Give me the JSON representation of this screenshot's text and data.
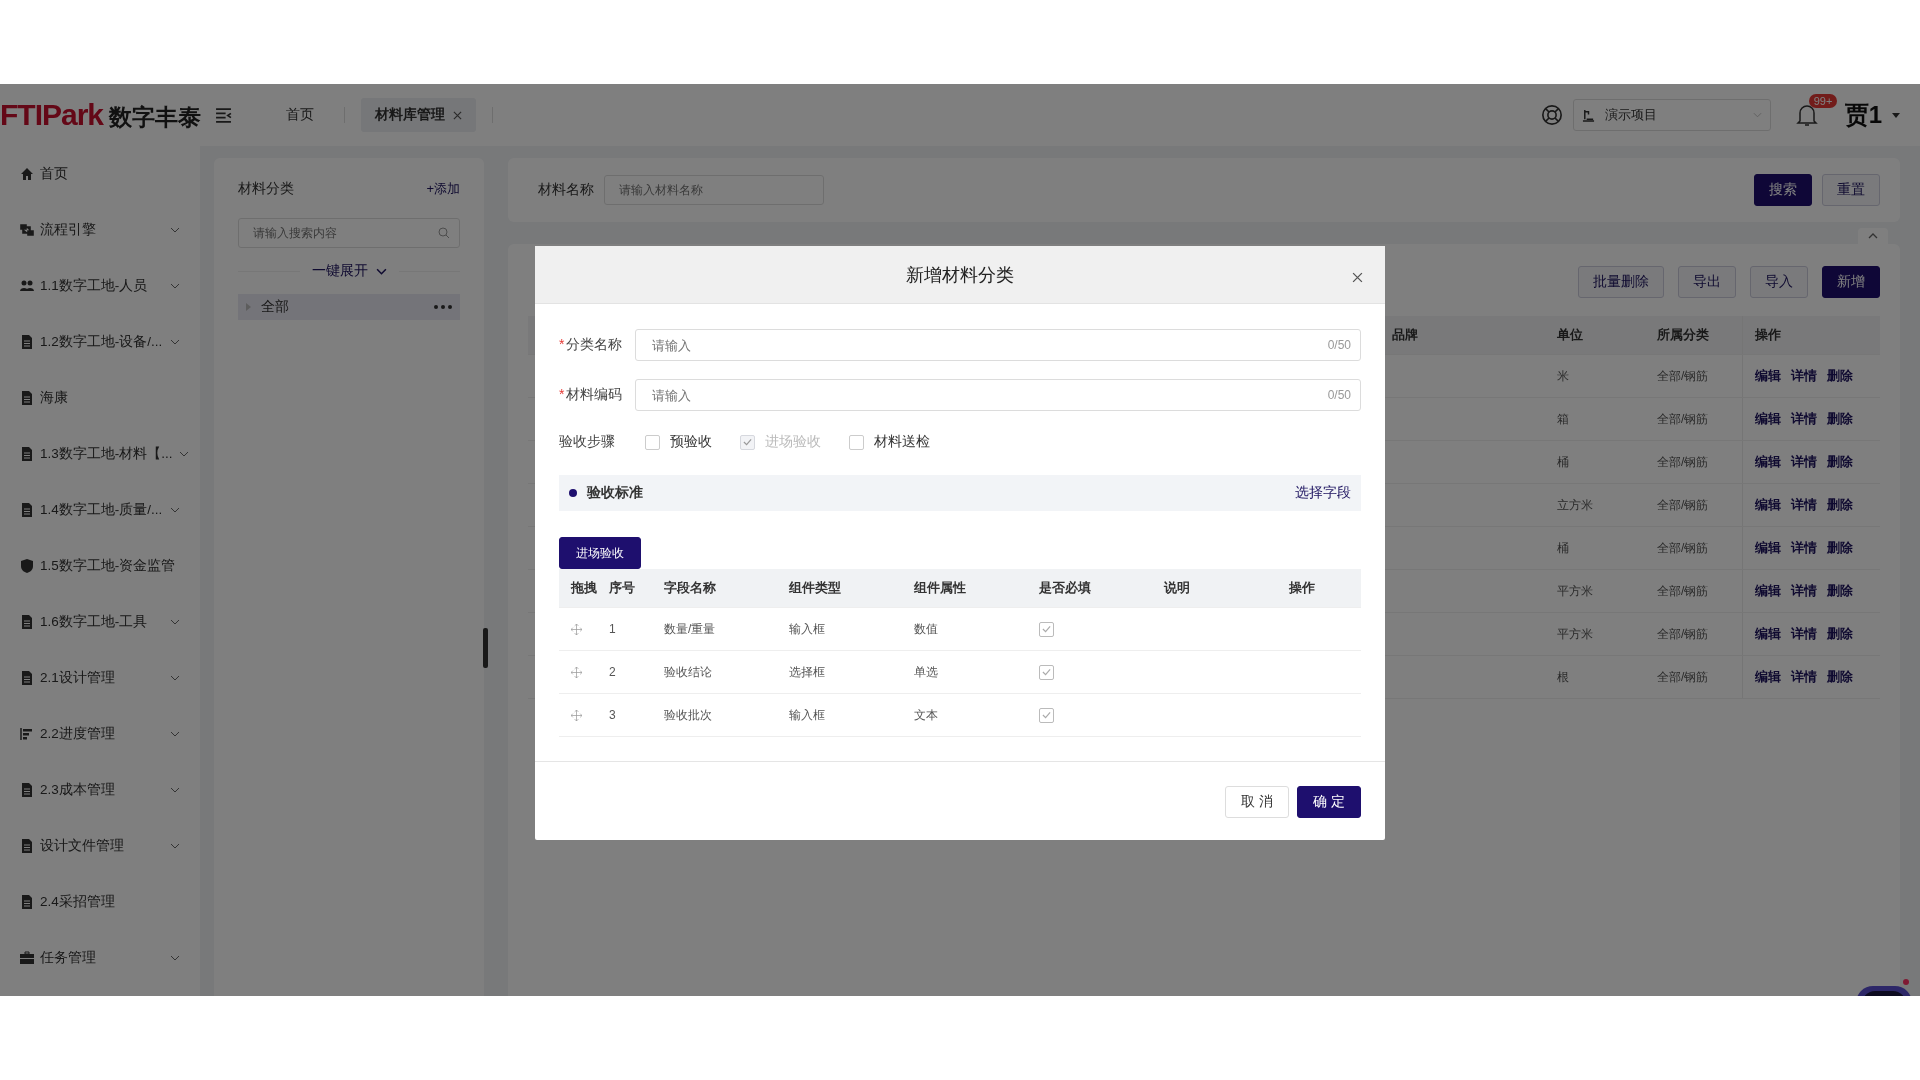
{
  "logo": {
    "brand": "FTIPark",
    "name": "数字丰泰"
  },
  "tabs": [
    {
      "label": "首页",
      "selected": false,
      "closable": false
    },
    {
      "label": "材料库管理",
      "selected": true,
      "closable": true
    }
  ],
  "project_select": {
    "value": "演示项目"
  },
  "notifications": {
    "badge": "99+"
  },
  "user": {
    "name": "贾1"
  },
  "sidebar": {
    "items": [
      {
        "label": "首页",
        "kind": "home",
        "expandable": false
      },
      {
        "label": "流程引擎",
        "kind": "flow",
        "expandable": true
      },
      {
        "label": "1.1数字工地-人员",
        "kind": "people",
        "expandable": true
      },
      {
        "label": "1.2数字工地-设备/...",
        "kind": "doc",
        "expandable": true
      },
      {
        "label": "海康",
        "kind": "doc",
        "expandable": false
      },
      {
        "label": "1.3数字工地-材料【...",
        "kind": "doc",
        "expandable": true
      },
      {
        "label": "1.4数字工地-质量/...",
        "kind": "doc",
        "expandable": true
      },
      {
        "label": "1.5数字工地-资金监管",
        "kind": "shield",
        "expandable": false
      },
      {
        "label": "1.6数字工地-工具",
        "kind": "doc",
        "expandable": true
      },
      {
        "label": "2.1设计管理",
        "kind": "doc",
        "expandable": true
      },
      {
        "label": "2.2进度管理",
        "kind": "gantt",
        "expandable": true
      },
      {
        "label": "2.3成本管理",
        "kind": "doc",
        "expandable": true
      },
      {
        "label": "设计文件管理",
        "kind": "doc",
        "expandable": true
      },
      {
        "label": "2.4采招管理",
        "kind": "doc",
        "expandable": false
      },
      {
        "label": "任务管理",
        "kind": "briefcase",
        "expandable": true
      }
    ]
  },
  "category_panel": {
    "title": "材料分类",
    "add_link": "+添加",
    "search": {
      "placeholder": "请输入搜索内容"
    },
    "expand_all": "一键展开",
    "tree": [
      {
        "label": "全部",
        "selected": true
      }
    ]
  },
  "search_bar": {
    "label": "材料名称",
    "placeholder": "请输入材料名称",
    "buttons": [
      {
        "label": "搜索",
        "kind": "primary"
      },
      {
        "label": "重置",
        "kind": "default"
      }
    ]
  },
  "toolbar": [
    {
      "label": "批量删除",
      "kind": "default"
    },
    {
      "label": "导出",
      "kind": "default"
    },
    {
      "label": "导入",
      "kind": "default"
    },
    {
      "label": "新增",
      "kind": "primary"
    }
  ],
  "table": {
    "columns": [
      "品牌",
      "单位",
      "所属分类",
      "操作"
    ],
    "rows": [
      {
        "unit": "米",
        "category": "全部/钢筋",
        "actions": [
          "编辑",
          "详情",
          "删除"
        ]
      },
      {
        "unit": "箱",
        "category": "全部/钢筋",
        "actions": [
          "编辑",
          "详情",
          "删除"
        ]
      },
      {
        "unit": "桶",
        "category": "全部/钢筋",
        "actions": [
          "编辑",
          "详情",
          "删除"
        ]
      },
      {
        "unit": "立方米",
        "category": "全部/钢筋",
        "actions": [
          "编辑",
          "详情",
          "删除"
        ]
      },
      {
        "unit": "桶",
        "category": "全部/钢筋",
        "actions": [
          "编辑",
          "详情",
          "删除"
        ]
      },
      {
        "unit": "平方米",
        "category": "全部/钢筋",
        "actions": [
          "编辑",
          "详情",
          "删除"
        ]
      },
      {
        "unit": "平方米",
        "category": "全部/钢筋",
        "actions": [
          "编辑",
          "详情",
          "删除"
        ]
      },
      {
        "unit": "根",
        "category": "全部/钢筋",
        "actions": [
          "编辑",
          "详情",
          "删除"
        ]
      }
    ]
  },
  "dialog": {
    "title": "新增材料分类",
    "fields": [
      {
        "label": "分类名称",
        "required_mark": "*",
        "placeholder": "请输入",
        "counter": "0/50"
      },
      {
        "label": "材料编码",
        "required_mark": "*",
        "placeholder": "请输入",
        "counter": "0/50"
      }
    ],
    "steps": {
      "label": "验收步骤",
      "options": [
        {
          "label": "预验收",
          "checked": false,
          "disabled": false
        },
        {
          "label": "进场验收",
          "checked": true,
          "disabled": true
        },
        {
          "label": "材料送检",
          "checked": false,
          "disabled": false
        }
      ]
    },
    "section": {
      "title": "验收标准",
      "link": "选择字段"
    },
    "stage_button": "进场验收",
    "grid": {
      "columns": [
        "拖拽",
        "序号",
        "字段名称",
        "组件类型",
        "组件属性",
        "是否必填",
        "说明",
        "操作"
      ],
      "rows": [
        {
          "index": "1",
          "name": "数量/重量",
          "type": "输入框",
          "attr": "数值",
          "required": true
        },
        {
          "index": "2",
          "name": "验收结论",
          "type": "选择框",
          "attr": "单选",
          "required": true
        },
        {
          "index": "3",
          "name": "验收批次",
          "type": "输入框",
          "attr": "文本",
          "required": true
        }
      ]
    },
    "buttons": [
      {
        "label": "取 消",
        "kind": "default"
      },
      {
        "label": "确 定",
        "kind": "primary"
      }
    ]
  }
}
